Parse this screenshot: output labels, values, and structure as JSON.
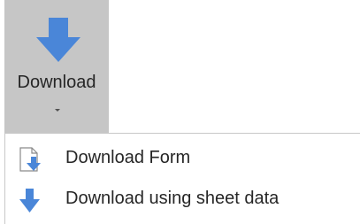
{
  "ribbon": {
    "download_button": {
      "label": "Download",
      "icon": "arrow-down-icon",
      "accent_color": "#4a86d8"
    }
  },
  "menu": {
    "items": [
      {
        "label": "Download Form",
        "icon": "document-download-icon"
      },
      {
        "label": "Download using sheet data",
        "icon": "arrow-down-icon"
      }
    ]
  }
}
